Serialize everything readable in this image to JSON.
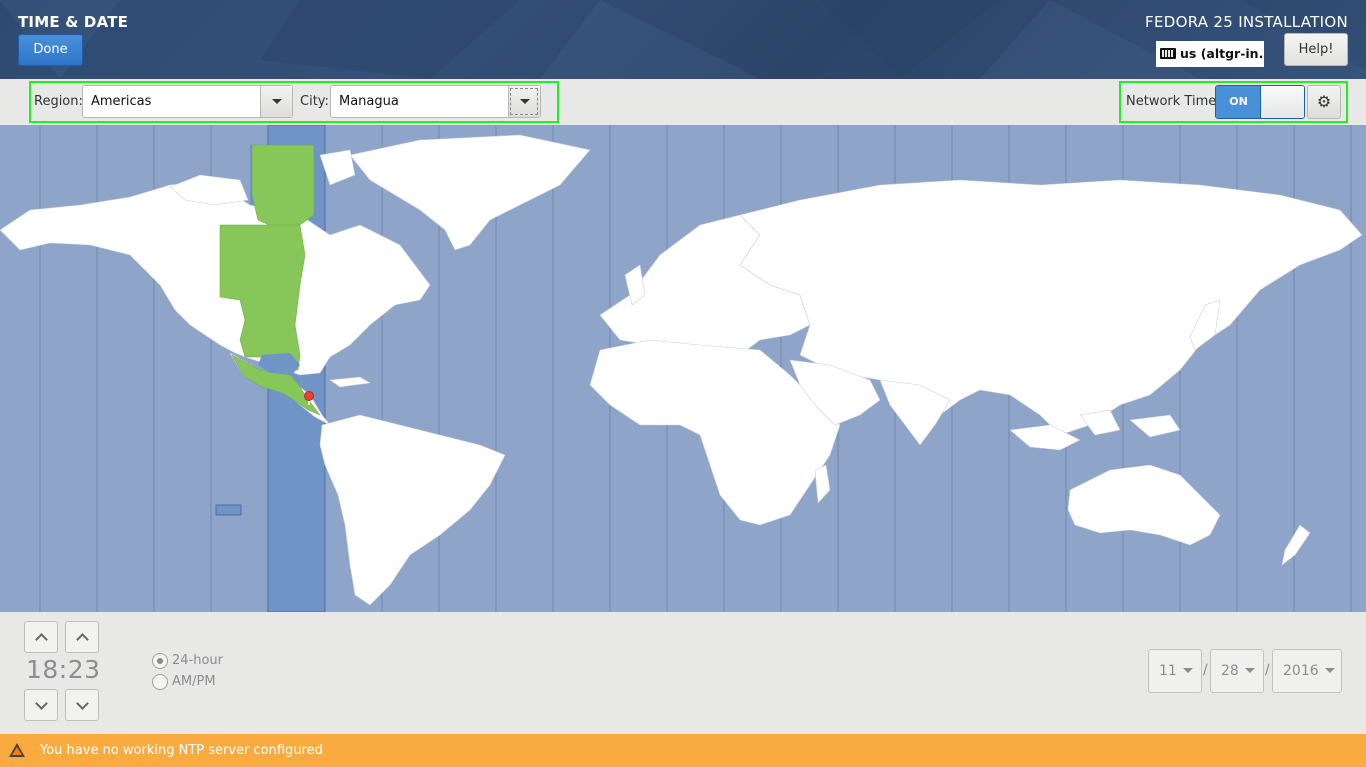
{
  "header": {
    "title": "TIME & DATE",
    "done_label": "Done",
    "product": "FEDORA 25 INSTALLATION",
    "keyboard_layout": "us (altgr-in...",
    "help_label": "Help!"
  },
  "location": {
    "region_label": "Region:",
    "region_value": "Americas",
    "city_label": "City:",
    "city_value": "Managua"
  },
  "network_time": {
    "label": "Network Time",
    "switch_label": "ON",
    "enabled": true,
    "settings_icon": "gear-icon"
  },
  "map": {
    "selected_timezone": "America/Managua",
    "colors": {
      "ocean": "#8ea4c8",
      "land": "#ffffff",
      "selected_zone_band": "#7093c8",
      "selected_zone_land": "#87c658",
      "pin": "#e8403a"
    }
  },
  "time": {
    "value": "18:23",
    "hours": "18",
    "minutes": "23",
    "format_options": [
      "24-hour",
      "AM/PM"
    ],
    "format_selected": "24-hour"
  },
  "date": {
    "month": "11",
    "day": "28",
    "year": "2016",
    "separator": "/"
  },
  "warning": {
    "message": "You have no working NTP server configured",
    "color": "#f9ab3f"
  }
}
